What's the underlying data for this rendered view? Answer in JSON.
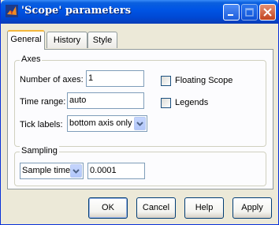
{
  "window": {
    "title": "'Scope' parameters",
    "controls": [
      "minimize-icon",
      "maximize-icon",
      "close-icon"
    ],
    "accent": "#0055e5"
  },
  "tabs": [
    {
      "label": "General",
      "active": true
    },
    {
      "label": "History",
      "active": false
    },
    {
      "label": "Style",
      "active": false
    }
  ],
  "axes": {
    "legend": "Axes",
    "number_of_axes_label": "Number of axes:",
    "number_of_axes_value": "1",
    "time_range_label": "Time range:",
    "time_range_value": "auto",
    "tick_labels_label": "Tick labels:",
    "tick_labels_value": "bottom axis only",
    "floating_scope_label": "Floating Scope",
    "floating_scope_checked": false,
    "legends_label": "Legends",
    "legends_checked": false
  },
  "sampling": {
    "legend": "Sampling",
    "mode_value": "Sample time",
    "value": "0.0001"
  },
  "buttons": {
    "ok": "OK",
    "cancel": "Cancel",
    "help": "Help",
    "apply": "Apply"
  }
}
